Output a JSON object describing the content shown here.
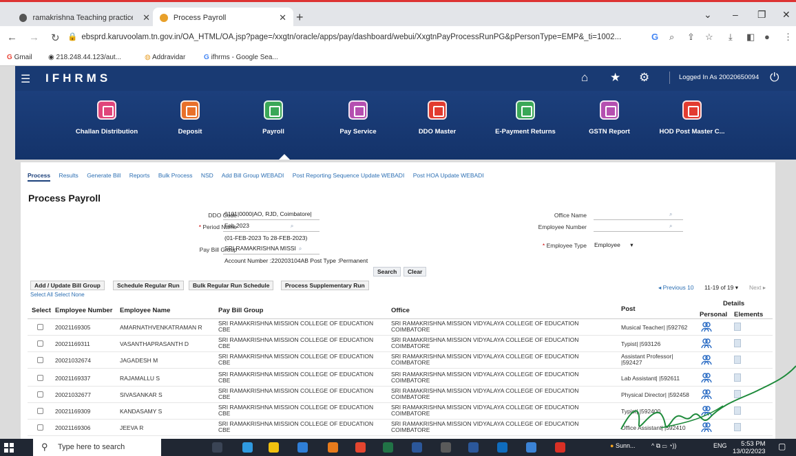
{
  "browser": {
    "tabs": [
      {
        "title": "ramakrishna Teaching practice-",
        "active": false
      },
      {
        "title": "Process Payroll",
        "active": true
      }
    ],
    "url": "ebsprd.karuvoolam.tn.gov.in/OA_HTML/OA.jsp?page=/xxgtn/oracle/apps/pay/dashboard/webui/XxgtnPayProcessRunPG&pPersonType=EMP&_ti=1002...",
    "bookmarks": [
      "Gmail",
      "218.248.44.123/aut...",
      "Addravidar",
      "ifhrms - Google Sea..."
    ]
  },
  "app": {
    "brand": "IFHRMS",
    "logged_in": "Logged In As 20020650094",
    "modules": [
      "Challan Distribution",
      "Deposit",
      "Payroll",
      "Pay Service",
      "DDO Master",
      "E-Payment Returns",
      "GSTN Report",
      "HOD Post Master C..."
    ],
    "module_colors": [
      "#e0457b",
      "#e8702a",
      "#3aa757",
      "#b54fb0",
      "#e23b2f",
      "#3aa757",
      "#b54fb0",
      "#e23b2f"
    ],
    "active_module": "Payroll"
  },
  "subnav": [
    "Process",
    "Results",
    "Generate Bill",
    "Reports",
    "Bulk Process",
    "NSD",
    "Add Bill Group WEBADI",
    "Post Reporting Sequence Update WEBADI",
    "Post HOA Update WEBADI"
  ],
  "page_title": "Process Payroll",
  "form": {
    "ddo_code_label": "DDO Code",
    "ddo_code": "0101|0000|AO, RJD, Coimbatore|",
    "period_name_label": "Period Name",
    "period_name": "Feb 2023",
    "period_range": "(01-FEB-2023 To 28-FEB-2023)",
    "pay_bill_group_label": "Pay Bill Group",
    "pay_bill_group": "SRI RAMAKRISHNA MISSI",
    "account_info": "Account Number :220203104AB Post Type :Permanent",
    "office_name_label": "Office Name",
    "employee_number_label": "Employee Number",
    "employee_type_label": "Employee Type",
    "employee_type": "Employee",
    "required_mark": "*",
    "search_btn": "Search",
    "clear_btn": "Clear"
  },
  "table_actions": [
    "Add / Update Bill Group",
    "Schedule Regular Run",
    "Bulk Regular Run Schedule",
    "Process Supplementary Run"
  ],
  "select_all": "Select All",
  "select_none": "Select None",
  "pager": {
    "previous": "Previous 10",
    "range": "11-19 of 19",
    "next": "Next"
  },
  "columns": {
    "select": "Select",
    "employee_number": "Employee Number",
    "employee_name": "Employee Name",
    "pay_bill_group": "Pay Bill Group",
    "office": "Office",
    "post": "Post",
    "details": "Details",
    "personal": "Personal",
    "elements": "Elements"
  },
  "rows": [
    {
      "num": "20021169305",
      "name": "AMARNATHVENKATRAMAN R",
      "group": "SRI RAMAKRISHNA MISSION COLLEGE OF EDUCATION",
      "group2": "CBE",
      "office": "SRI RAMAKRISHNA MISSION VIDYALAYA COLLEGE OF EDUCATION",
      "office2": "COIMBATORE",
      "post": "Musical Teacher| |592762",
      "post2": ""
    },
    {
      "num": "20021169311",
      "name": "VASANTHAPRASANTH D",
      "group": "SRI RAMAKRISHNA MISSION COLLEGE OF EDUCATION",
      "group2": "CBE",
      "office": "SRI RAMAKRISHNA MISSION VIDYALAYA COLLEGE OF EDUCATION",
      "office2": "COIMBATORE",
      "post": "Typist| |593126",
      "post2": ""
    },
    {
      "num": "20021032674",
      "name": "JAGADESH M",
      "group": "SRI RAMAKRISHNA MISSION COLLEGE OF EDUCATION",
      "group2": "CBE",
      "office": "SRI RAMAKRISHNA MISSION VIDYALAYA COLLEGE OF EDUCATION",
      "office2": "COIMBATORE",
      "post": "Assistant Professor|",
      "post2": "|592427"
    },
    {
      "num": "20021169337",
      "name": "RAJAMALLU S",
      "group": "SRI RAMAKRISHNA MISSION COLLEGE OF EDUCATION",
      "group2": "CBE",
      "office": "SRI RAMAKRISHNA MISSION VIDYALAYA COLLEGE OF EDUCATION",
      "office2": "COIMBATORE",
      "post": "Lab Assistant| |592611",
      "post2": ""
    },
    {
      "num": "20021032677",
      "name": "SIVASANKAR S",
      "group": "SRI RAMAKRISHNA MISSION COLLEGE OF EDUCATION",
      "group2": "CBE",
      "office": "SRI RAMAKRISHNA MISSION VIDYALAYA COLLEGE OF EDUCATION",
      "office2": "COIMBATORE",
      "post": "Physical Director| |592458",
      "post2": ""
    },
    {
      "num": "20021169309",
      "name": "KANDASAMY S",
      "group": "SRI RAMAKRISHNA MISSION COLLEGE OF EDUCATION",
      "group2": "CBE",
      "office": "SRI RAMAKRISHNA MISSION VIDYALAYA COLLEGE OF EDUCATION",
      "office2": "COIMBATORE",
      "post": "Typist| |592400",
      "post2": ""
    },
    {
      "num": "20021169306",
      "name": "JEEVA R",
      "group": "SRI RAMAKRISHNA MISSION COLLEGE OF EDUCATION",
      "group2": "CBE",
      "office": "SRI RAMAKRISHNA MISSION VIDYALAYA COLLEGE OF EDUCATION",
      "office2": "COIMBATORE",
      "post": "Office Assistant| |592410",
      "post2": ""
    }
  ],
  "taskbar": {
    "search_placeholder": "Type here to search",
    "weather": "Sunn...",
    "lang": "ENG",
    "time": "5:53 PM",
    "date": "13/02/2023"
  }
}
